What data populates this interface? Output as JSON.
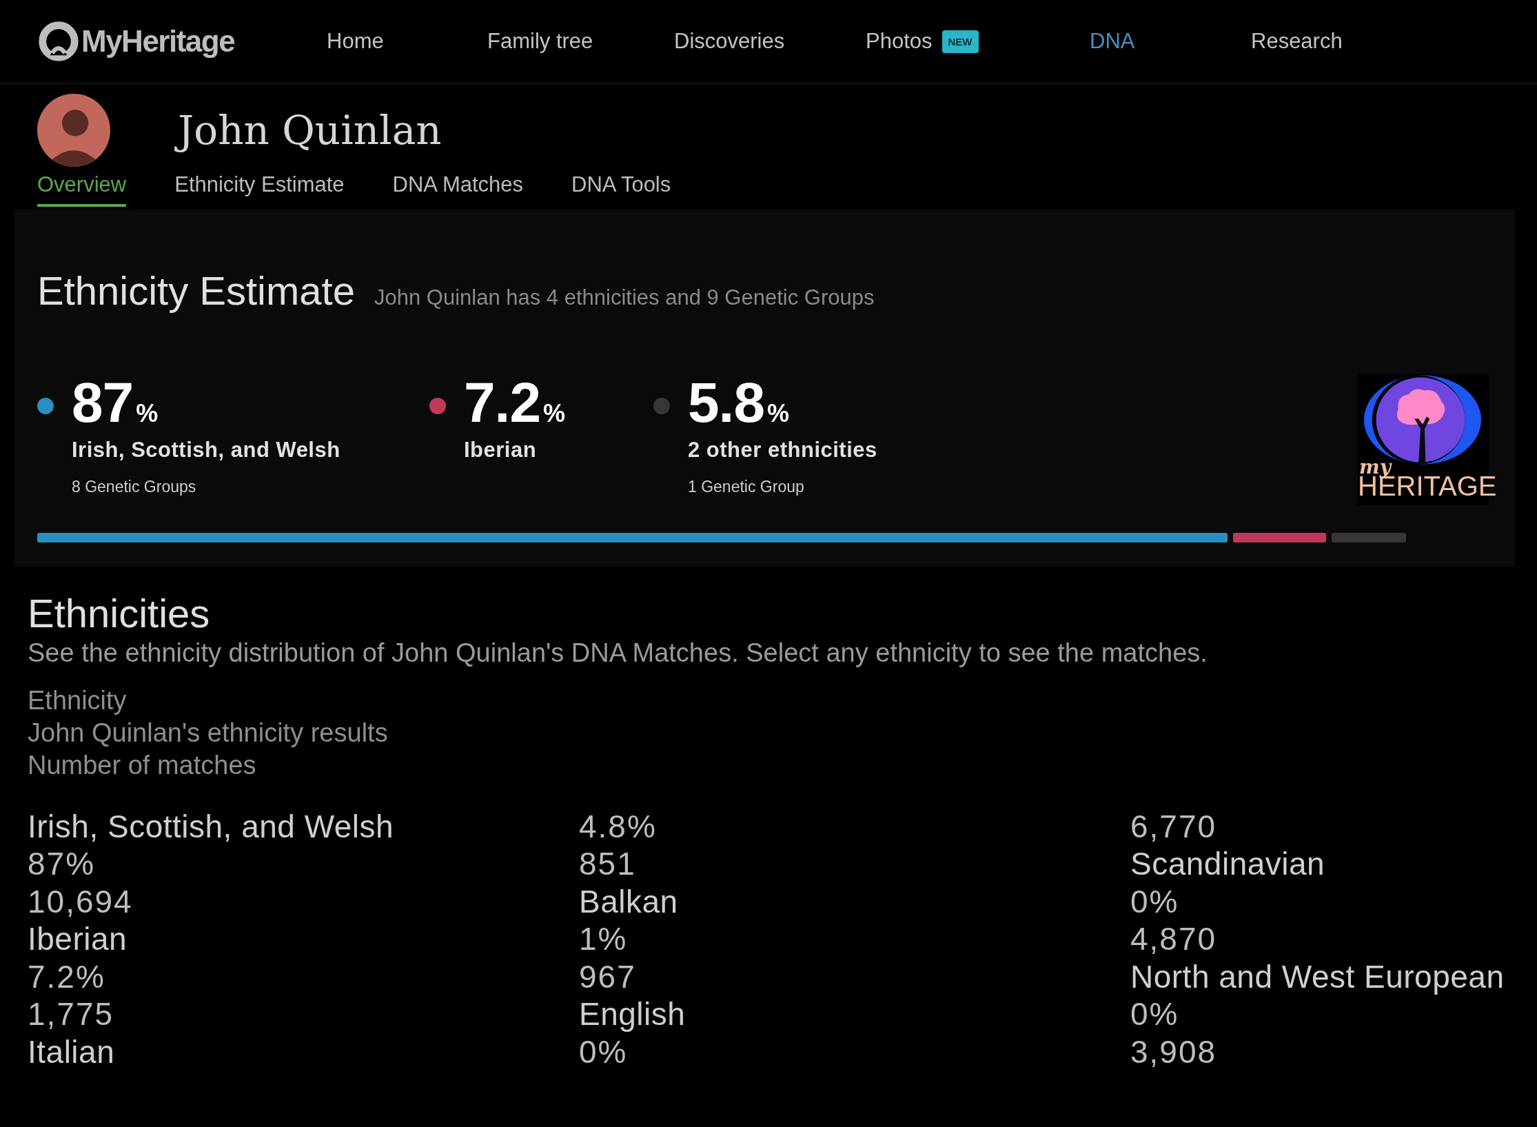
{
  "header": {
    "logo": "MyHeritage",
    "nav": [
      {
        "label": "Home",
        "selected": false
      },
      {
        "label": "Family tree",
        "selected": false
      },
      {
        "label": "Discoveries",
        "selected": false
      },
      {
        "label": "Photos",
        "selected": false,
        "badge": "NEW"
      },
      {
        "label": "DNA",
        "selected": true
      },
      {
        "label": "Research",
        "selected": false
      }
    ]
  },
  "profile": {
    "name": "John Quinlan",
    "tabs": [
      {
        "label": "Overview",
        "selected": true
      },
      {
        "label": "Ethnicity Estimate",
        "selected": false
      },
      {
        "label": "DNA Matches",
        "selected": false
      },
      {
        "label": "DNA Tools",
        "selected": false
      }
    ]
  },
  "estimate": {
    "title": "Ethnicity Estimate",
    "subtitle": "John Quinlan has 4 ethnicities and 9 Genetic Groups",
    "stats": [
      {
        "value": "87",
        "unit": "%",
        "label": "Irish, Scottish, and Welsh",
        "groups": "8 Genetic Groups",
        "color": "#2a8fbf"
      },
      {
        "value": "7.2",
        "unit": "%",
        "label": "Iberian",
        "color": "#c0395a"
      },
      {
        "value": "5.8",
        "unit": "%",
        "label": "2 other ethnicities",
        "groups": "1 Genetic Group",
        "color": "#3a3633"
      }
    ],
    "logo": {
      "small": "my",
      "big": "HERITAGE"
    }
  },
  "ethnicities": {
    "title": "Ethnicities",
    "description": "See the ethnicity distribution of John Quinlan's DNA Matches. Select any ethnicity to see the matches.",
    "headers": [
      "Ethnicity",
      "John Quinlan's ethnicity results",
      "Number of matches"
    ],
    "cells": [
      {
        "text": "Irish, Scottish, and Welsh",
        "kind": "name"
      },
      {
        "text": "4.8%",
        "kind": "value"
      },
      {
        "text": "6,770",
        "kind": "value"
      },
      {
        "text": "87%",
        "kind": "value"
      },
      {
        "text": "851",
        "kind": "value"
      },
      {
        "text": "Scandinavian",
        "kind": "name"
      },
      {
        "text": "10,694",
        "kind": "value"
      },
      {
        "text": "Balkan",
        "kind": "name"
      },
      {
        "text": "0%",
        "kind": "value"
      },
      {
        "text": "Iberian",
        "kind": "name"
      },
      {
        "text": "1%",
        "kind": "value"
      },
      {
        "text": "4,870",
        "kind": "value"
      },
      {
        "text": "7.2%",
        "kind": "value"
      },
      {
        "text": "967",
        "kind": "value"
      },
      {
        "text": "North and West European",
        "kind": "name"
      },
      {
        "text": "1,775",
        "kind": "value"
      },
      {
        "text": "English",
        "kind": "name"
      },
      {
        "text": "0%",
        "kind": "value"
      },
      {
        "text": "Italian",
        "kind": "name"
      },
      {
        "text": "0%",
        "kind": "value"
      },
      {
        "text": "3,908",
        "kind": "value"
      }
    ]
  }
}
